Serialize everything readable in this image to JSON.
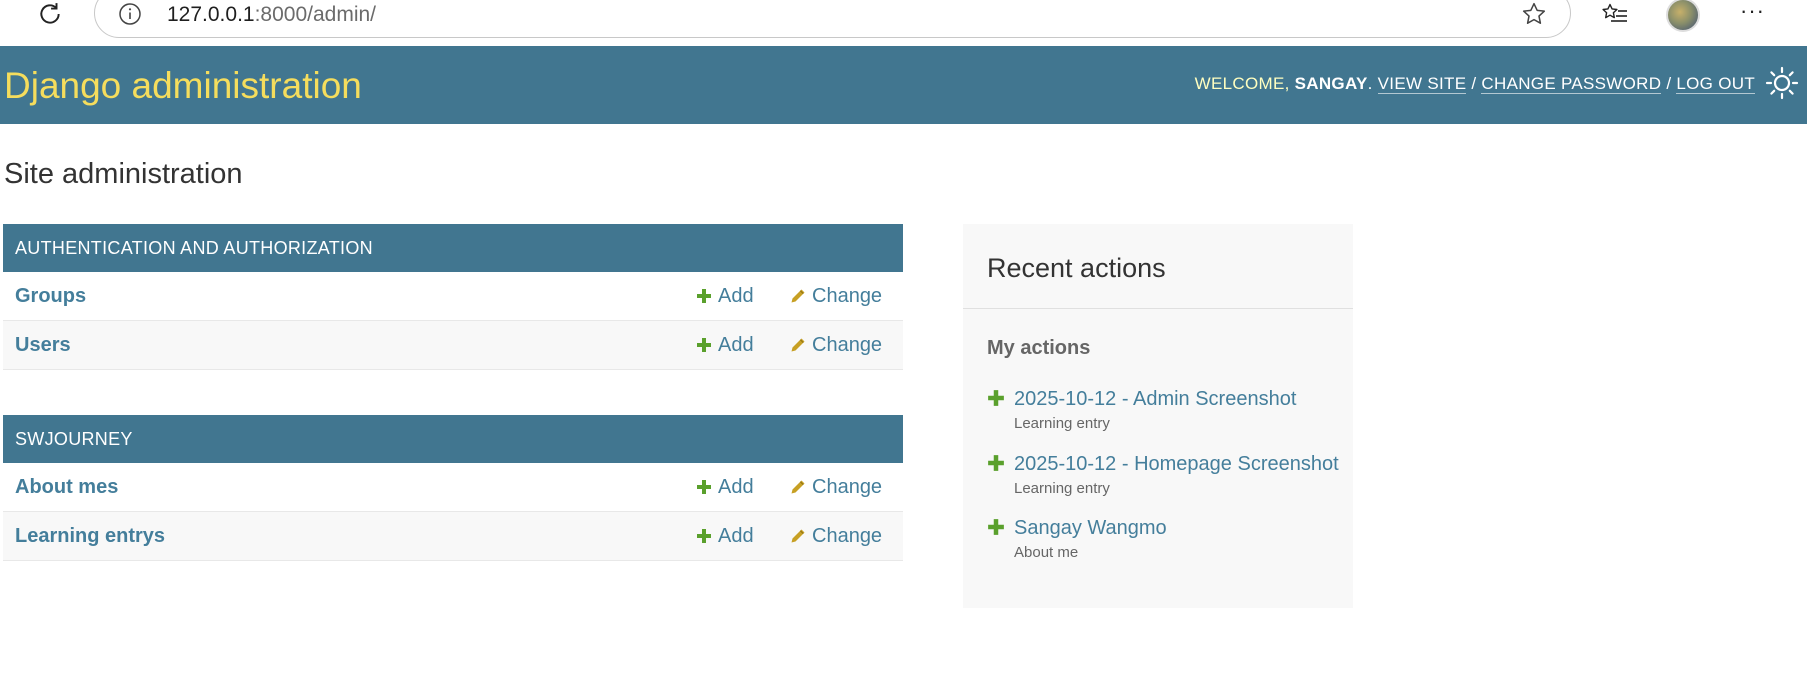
{
  "browser": {
    "url_host": "127.0.0.1",
    "url_path": ":8000/admin/"
  },
  "header": {
    "branding": "Django administration",
    "welcome": "WELCOME, ",
    "username": "SANGAY",
    "view_site": "VIEW SITE",
    "change_password": "CHANGE PASSWORD",
    "log_out": "LOG OUT",
    "separator": "/"
  },
  "page_title": "Site administration",
  "apps": [
    {
      "caption": "AUTHENTICATION AND AUTHORIZATION",
      "models": [
        {
          "name": "Groups",
          "add": "Add",
          "change": "Change"
        },
        {
          "name": "Users",
          "add": "Add",
          "change": "Change"
        }
      ]
    },
    {
      "caption": "SWJOURNEY",
      "models": [
        {
          "name": "About mes",
          "add": "Add",
          "change": "Change"
        },
        {
          "name": "Learning entrys",
          "add": "Add",
          "change": "Change"
        }
      ]
    }
  ],
  "recent": {
    "title": "Recent actions",
    "subtitle": "My actions",
    "actions": [
      {
        "title": "2025-10-12 - Admin Screenshot",
        "type": "Learning entry"
      },
      {
        "title": "2025-10-12 - Homepage Screenshot",
        "type": "Learning entry"
      },
      {
        "title": "Sangay Wangmo",
        "type": "About me"
      }
    ]
  },
  "colors": {
    "header_bg": "#417690",
    "branding": "#f5dd5d",
    "link": "#447e9b",
    "add_green": "#5aa02c",
    "change_yellow": "#c7a024"
  }
}
